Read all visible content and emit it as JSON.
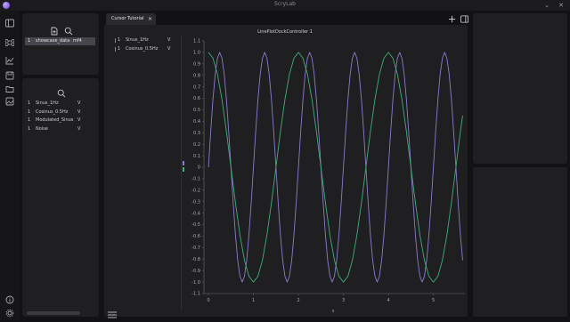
{
  "app": {
    "title": "ScryLab",
    "window_controls": [
      "⌄",
      "✕"
    ]
  },
  "activity_bar": {
    "icons": [
      "sidebar-toggle-icon",
      "command-icon",
      "chart-icon",
      "save-icon",
      "folder-icon",
      "image-icon",
      "info-icon",
      "settings-icon"
    ]
  },
  "files_panel": {
    "file": {
      "name": "showcase_data",
      "ext": "mf4",
      "index": "1"
    }
  },
  "signals_panel": {
    "signals": [
      {
        "index": "1",
        "name": "Sinus_1Hz",
        "unit": "V"
      },
      {
        "index": "1",
        "name": "Cosinus_0.5Hz",
        "unit": "V"
      },
      {
        "index": "1",
        "name": "Modulated_Sinus",
        "unit": "V"
      },
      {
        "index": "1",
        "name": "Noise",
        "unit": "V"
      }
    ]
  },
  "tabs": [
    {
      "label": "Cursor Tutorial",
      "close": "✕"
    }
  ],
  "legend": [
    {
      "index": "1",
      "name": "Sinus_1Hz",
      "unit": "V",
      "color": "#8a7bd0"
    },
    {
      "index": "1",
      "name": "Cosinus_0.5Hz",
      "unit": "V",
      "color": "#3fb07a"
    }
  ],
  "chart_data": {
    "type": "line",
    "title": "LinePlotDockController 1",
    "xlabel": "s",
    "ylabel": "",
    "xlim": [
      -0.1,
      5.7
    ],
    "ylim": [
      -1.1,
      1.1
    ],
    "x_ticks": [
      "0",
      "1",
      "2",
      "3",
      "4",
      "5"
    ],
    "y_ticks": [
      "1.1",
      "1.0",
      "0.9",
      "0.8",
      "0.7",
      "0.6",
      "0.5",
      "0.4",
      "0.3",
      "0.2",
      "0.1",
      "0",
      "-0.1",
      "-0.2",
      "-0.3",
      "-0.4",
      "-0.5",
      "-0.6",
      "-0.7",
      "-0.8",
      "-0.9",
      "-1.0",
      "-1.1"
    ],
    "grid": false,
    "series": [
      {
        "name": "Sinus_1Hz",
        "color": "#8a7bd0",
        "x": [
          0,
          0.05,
          0.1,
          0.15,
          0.2,
          0.25,
          0.3,
          0.35,
          0.4,
          0.45,
          0.5,
          0.55,
          0.6,
          0.65,
          0.7,
          0.75,
          0.8,
          0.85,
          0.9,
          0.95,
          1.0,
          1.05,
          1.1,
          1.15,
          1.2,
          1.25,
          1.3,
          1.35,
          1.4,
          1.45,
          1.5,
          1.55,
          1.6,
          1.65,
          1.7,
          1.75,
          1.8,
          1.85,
          1.9,
          1.95,
          2.0,
          2.05,
          2.1,
          2.15,
          2.2,
          2.25,
          2.3,
          2.35,
          2.4,
          2.45,
          2.5,
          2.55,
          2.6,
          2.65,
          2.7,
          2.75,
          2.8,
          2.85,
          2.9,
          2.95,
          3.0,
          3.05,
          3.1,
          3.15,
          3.2,
          3.25,
          3.3,
          3.35,
          3.4,
          3.45,
          3.5,
          3.55,
          3.6,
          3.65,
          3.7,
          3.75,
          3.8,
          3.85,
          3.9,
          3.95,
          4.0,
          4.05,
          4.1,
          4.15,
          4.2,
          4.25,
          4.3,
          4.35,
          4.4,
          4.45,
          4.5,
          4.55,
          4.6,
          4.65,
          4.7,
          4.75,
          4.8,
          4.85,
          4.9,
          4.95,
          5.0,
          5.05,
          5.1,
          5.15,
          5.2,
          5.25,
          5.3,
          5.35,
          5.4,
          5.45,
          5.5,
          5.55,
          5.6,
          5.65
        ],
        "y": [
          0,
          0.31,
          0.59,
          0.81,
          0.95,
          1.0,
          0.95,
          0.81,
          0.59,
          0.31,
          0,
          -0.31,
          -0.59,
          -0.81,
          -0.95,
          -1.0,
          -0.95,
          -0.81,
          -0.59,
          -0.31,
          0,
          0.31,
          0.59,
          0.81,
          0.95,
          1.0,
          0.95,
          0.81,
          0.59,
          0.31,
          0,
          -0.31,
          -0.59,
          -0.81,
          -0.95,
          -1.0,
          -0.95,
          -0.81,
          -0.59,
          -0.31,
          0,
          0.31,
          0.59,
          0.81,
          0.95,
          1.0,
          0.95,
          0.81,
          0.59,
          0.31,
          0,
          -0.31,
          -0.59,
          -0.81,
          -0.95,
          -1.0,
          -0.95,
          -0.81,
          -0.59,
          -0.31,
          0,
          0.31,
          0.59,
          0.81,
          0.95,
          1.0,
          0.95,
          0.81,
          0.59,
          0.31,
          0,
          -0.31,
          -0.59,
          -0.81,
          -0.95,
          -1.0,
          -0.95,
          -0.81,
          -0.59,
          -0.31,
          0,
          0.31,
          0.59,
          0.81,
          0.95,
          1.0,
          0.95,
          0.81,
          0.59,
          0.31,
          0,
          -0.31,
          -0.59,
          -0.81,
          -0.95,
          -1.0,
          -0.95,
          -0.81,
          -0.59,
          -0.31,
          0,
          0.31,
          0.59,
          0.81,
          0.95,
          1.0,
          0.95,
          0.81,
          0.59,
          0.31,
          0,
          -0.31,
          -0.59,
          -0.81
        ]
      },
      {
        "name": "Cosinus_0.5Hz",
        "color": "#3fb07a",
        "x": [
          0,
          0.1,
          0.2,
          0.3,
          0.4,
          0.5,
          0.6,
          0.7,
          0.8,
          0.9,
          1.0,
          1.1,
          1.2,
          1.3,
          1.4,
          1.5,
          1.6,
          1.7,
          1.8,
          1.9,
          2.0,
          2.1,
          2.2,
          2.3,
          2.4,
          2.5,
          2.6,
          2.7,
          2.8,
          2.9,
          3.0,
          3.1,
          3.2,
          3.3,
          3.4,
          3.5,
          3.6,
          3.7,
          3.8,
          3.9,
          4.0,
          4.1,
          4.2,
          4.3,
          4.4,
          4.5,
          4.6,
          4.7,
          4.8,
          4.9,
          5.0,
          5.1,
          5.2,
          5.3,
          5.4,
          5.5,
          5.6,
          5.65
        ],
        "y": [
          1.0,
          0.95,
          0.81,
          0.59,
          0.31,
          0,
          -0.31,
          -0.59,
          -0.81,
          -0.95,
          -1.0,
          -0.95,
          -0.81,
          -0.59,
          -0.31,
          0,
          0.31,
          0.59,
          0.81,
          0.95,
          1.0,
          0.95,
          0.81,
          0.59,
          0.31,
          0,
          -0.31,
          -0.59,
          -0.81,
          -0.95,
          -1.0,
          -0.95,
          -0.81,
          -0.59,
          -0.31,
          0,
          0.31,
          0.59,
          0.81,
          0.95,
          1.0,
          0.95,
          0.81,
          0.59,
          0.31,
          0,
          -0.31,
          -0.59,
          -0.81,
          -0.95,
          -1.0,
          -0.95,
          -0.81,
          -0.59,
          -0.31,
          0,
          0.31,
          0.45
        ]
      }
    ]
  }
}
